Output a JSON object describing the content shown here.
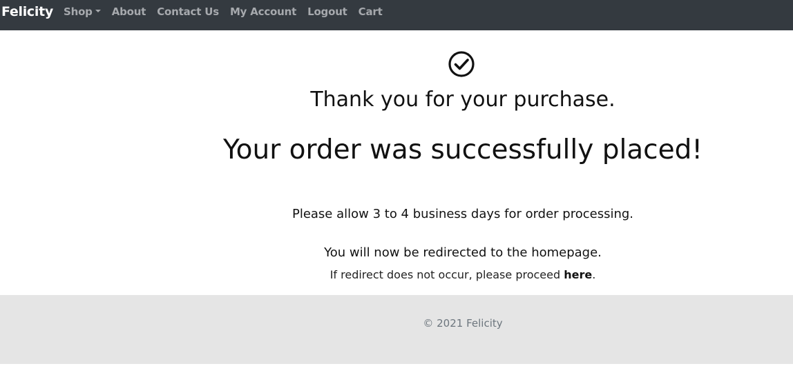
{
  "navbar": {
    "brand": "Felicity",
    "links": {
      "shop": "Shop",
      "about": "About",
      "contact": "Contact Us",
      "account": "My Account",
      "logout": "Logout",
      "cart": "Cart"
    }
  },
  "main": {
    "icon": "check-circle-icon",
    "thanks": "Thank you for your purchase.",
    "success": "Your order was successfully placed!",
    "processing": "Please allow 3 to 4 business days for order processing.",
    "redirect": "You will now be redirected to the homepage.",
    "proceed_prefix": "If redirect does not occur, please proceed ",
    "proceed_link": "here",
    "proceed_suffix": "."
  },
  "footer": {
    "copyright": "© 2021 Felicity"
  },
  "colors": {
    "navbar_bg": "#343a40",
    "nav_link": "#a6a9ad",
    "footer_bg": "#e5e5e5",
    "footer_text": "#6c757d"
  }
}
